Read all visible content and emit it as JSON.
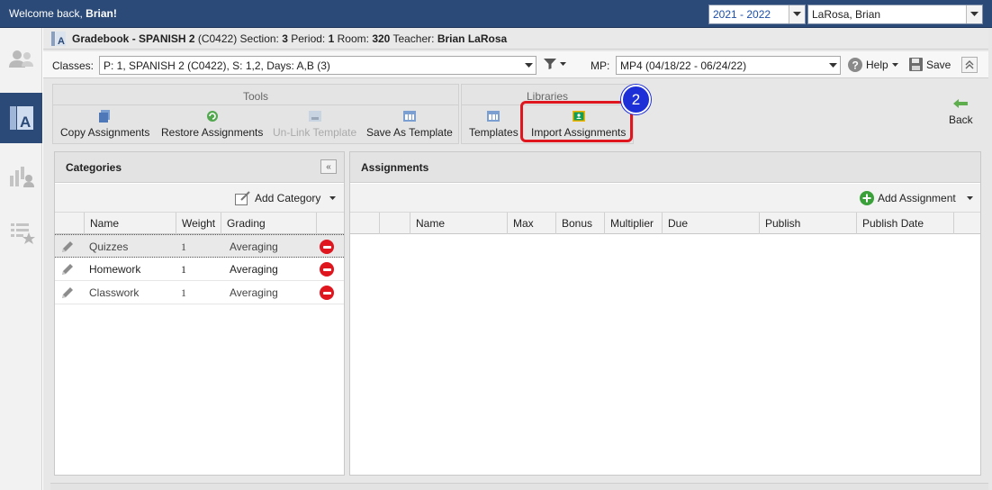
{
  "topbar": {
    "welcome_prefix": "Welcome back, ",
    "welcome_name": "Brian!",
    "year": "2021 - 2022",
    "user": "LaRosa, Brian"
  },
  "title": {
    "label": "Gradebook",
    "sep": " - ",
    "course": "SPANISH 2",
    "code": " (C0422) Section: ",
    "section": "3",
    "period_label": " Period: ",
    "period": "1",
    "room_label": " Room: ",
    "room": "320",
    "teacher_label": " Teacher: ",
    "teacher": "Brian LaRosa"
  },
  "classbar": {
    "classes_label": "Classes:",
    "classes_value": "P: 1, SPANISH 2 (C0422), S: 1,2, Days: A,B (3)",
    "mp_label": "MP:",
    "mp_value": "MP4 (04/18/22 - 06/24/22)",
    "help": "Help",
    "save": "Save"
  },
  "toolbar": {
    "tools_title": "Tools",
    "libraries_title": "Libraries",
    "copy": "Copy Assignments",
    "restore": "Restore Assignments",
    "unlink": "Un-Link Template",
    "save_template": "Save As Template",
    "templates": "Templates",
    "import": "Import Assignments",
    "back": "Back"
  },
  "step_number": "2",
  "categories": {
    "title": "Categories",
    "collapse": "«",
    "add": "Add Category",
    "columns": [
      "Name",
      "Weight",
      "Grading"
    ],
    "rows": [
      {
        "name": "Quizzes",
        "weight": "1",
        "grading": "Averaging"
      },
      {
        "name": "Homework",
        "weight": "1",
        "grading": "Averaging"
      },
      {
        "name": "Classwork",
        "weight": "1",
        "grading": "Averaging"
      }
    ]
  },
  "assignments": {
    "title": "Assignments",
    "add": "Add Assignment",
    "columns": [
      "Name",
      "Max",
      "Bonus",
      "Multiplier",
      "Due",
      "Publish",
      "Publish Date"
    ]
  },
  "colors": {
    "topbar": "#2b4a78",
    "highlight": "#e0161f",
    "badge": "#1d2fd6",
    "add_green": "#3aa13a"
  }
}
